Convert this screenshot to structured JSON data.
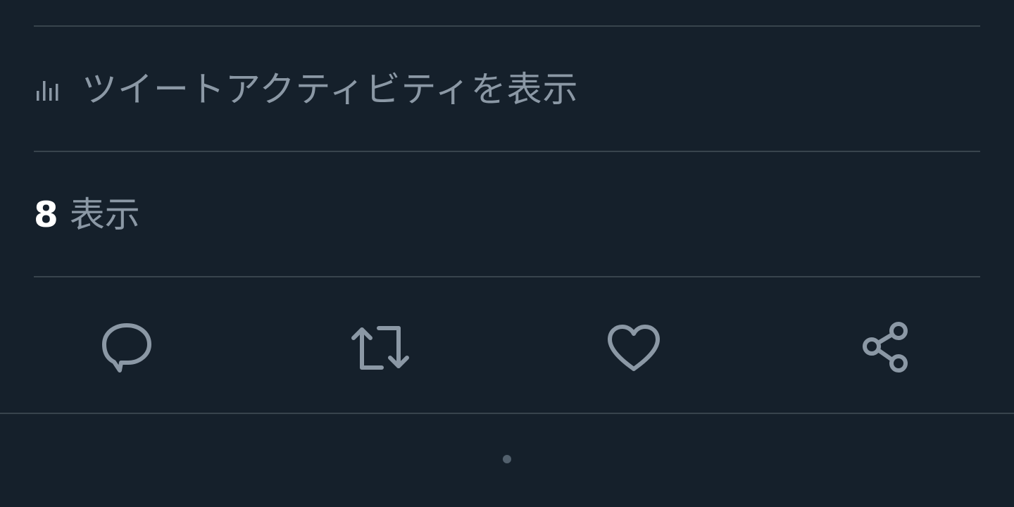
{
  "activity": {
    "icon": "bar-chart-icon",
    "label": "ツイートアクティビティを表示"
  },
  "views": {
    "count": "8",
    "label": "表示"
  },
  "actions": [
    {
      "name": "reply",
      "icon": "comment-icon"
    },
    {
      "name": "retweet",
      "icon": "retweet-icon"
    },
    {
      "name": "like",
      "icon": "heart-icon"
    },
    {
      "name": "share",
      "icon": "share-icon"
    }
  ],
  "colors": {
    "background": "#15202b",
    "divider": "#38444d",
    "secondary_text": "#8b98a5",
    "primary_text": "#ffffff",
    "icon": "#8b98a5"
  }
}
